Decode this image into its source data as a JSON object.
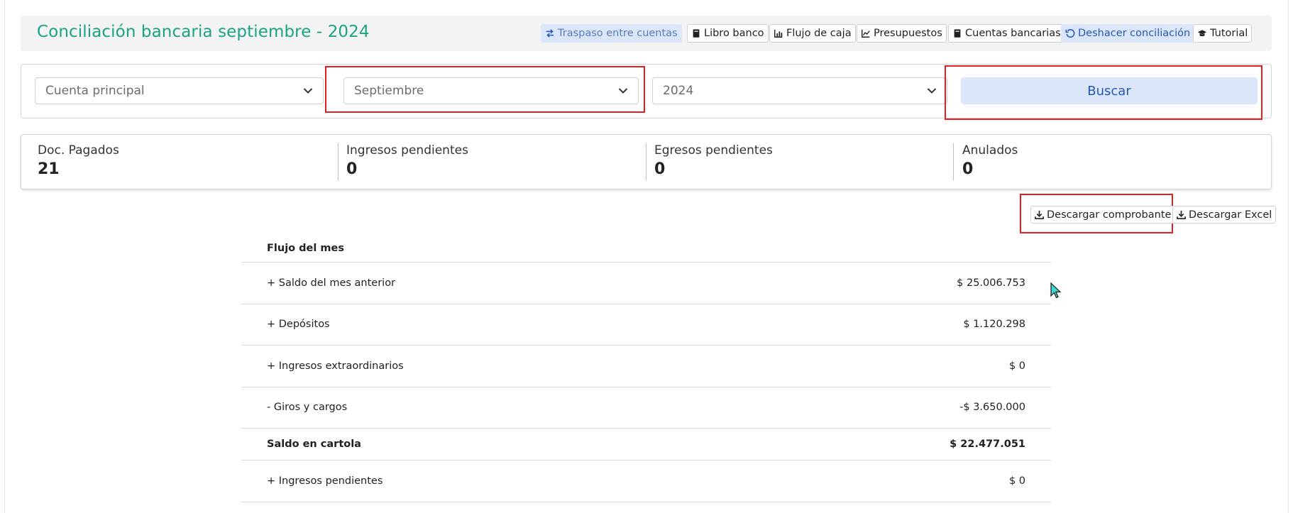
{
  "header": {
    "title": "Conciliación bancaria septiembre - 2024",
    "buttons": [
      {
        "label": "Traspaso entre cuentas",
        "icon": "transfer-icon"
      },
      {
        "label": "Libro banco",
        "icon": "book-icon"
      },
      {
        "label": "Flujo de caja",
        "icon": "bar-chart-icon"
      },
      {
        "label": "Presupuestos",
        "icon": "line-chart-icon"
      },
      {
        "label": "Cuentas bancarias",
        "icon": "book-icon"
      },
      {
        "label": "Deshacer conciliación",
        "icon": "undo-icon"
      },
      {
        "label": "Tutorial",
        "icon": "graduation-cap-icon"
      }
    ]
  },
  "filters": {
    "account": "Cuenta principal",
    "month": "Septiembre",
    "year": "2024",
    "search_label": "Buscar"
  },
  "stats": [
    {
      "label": "Doc. Pagados",
      "value": "21"
    },
    {
      "label": "Ingresos pendientes",
      "value": "0"
    },
    {
      "label": "Egresos pendientes",
      "value": "0"
    },
    {
      "label": "Anulados",
      "value": "0"
    }
  ],
  "downloads": {
    "receipt_label": "Descargar comprobante",
    "excel_label": "Descargar Excel"
  },
  "flow": {
    "heading": "Flujo del mes",
    "rows": [
      {
        "label": "+ Saldo del mes anterior",
        "amount": "$ 25.006.753"
      },
      {
        "label": "+ Depósitos",
        "amount": "$ 1.120.298"
      },
      {
        "label": "+ Ingresos extraordinarios",
        "amount": "$ 0"
      },
      {
        "label": "- Giros y cargos",
        "amount": "-$ 3.650.000"
      },
      {
        "label": "Saldo en cartola",
        "amount": "$ 22.477.051"
      },
      {
        "label": "+ Ingresos pendientes",
        "amount": "$ 0"
      }
    ]
  },
  "colors": {
    "title": "#1aa385",
    "accent_blue": "#2458b5",
    "accent_blue_bg": "#dbe6fb",
    "highlight_red": "#e41f1f"
  }
}
